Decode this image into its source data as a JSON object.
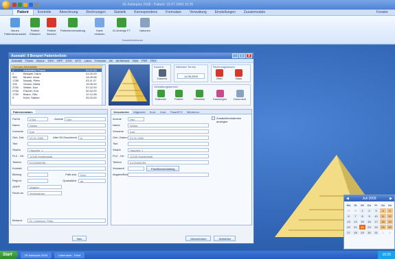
{
  "titlebar": {
    "title": "ZE Asklepios 2008 - Patient: 22.07.2009 10:25",
    "quick_access_colors": [
      "#d5372b",
      "#3d8f2e",
      "#e6b21c",
      "#2b6fd6",
      "#8a8a8a"
    ]
  },
  "menubar": {
    "tabs": [
      "Patient",
      "Kontrolle",
      "Abrechnung",
      "Rechnungen",
      "Statistik",
      "Korrespondenz",
      "Formulare",
      "Verwaltung",
      "Einstellungen",
      "Zusatzmodule"
    ],
    "active": 0,
    "right": "Fenster"
  },
  "ribbon": {
    "buttons": [
      {
        "label": "Neues Patientenauswahl",
        "color": "#5a9be0"
      },
      {
        "label": "Patient Erfassen",
        "color": "#3e9b3a"
      },
      {
        "label": "Patient löschen",
        "color": "#d5372b"
      },
      {
        "label": "Patientenverwaltung",
        "color": "#3e9b3a"
      },
      {
        "label": "Karte einlesen",
        "color": "#7aa6e6"
      },
      {
        "label": "ID-Anzeige F7",
        "color": "#3e9b3a"
      },
      {
        "label": "Optionen",
        "color": "#8aa2c2"
      }
    ],
    "group_label": "Zusatzfunktionen"
  },
  "window": {
    "title": "Auswahl: 0  Beispiel  Patientenliste",
    "controls": [
      "_",
      "□",
      "X"
    ],
    "alphabet": [
      "Auswahl",
      "Praxis",
      "Bonus",
      "GKV",
      "HPF",
      "KOS",
      "KFO",
      "Labor",
      "Formular",
      "Alt",
      "ab Behand",
      "Hkst",
      "PSR",
      "PKV"
    ],
    "list_header": "Chequer  Arbeitsliste",
    "list_rows": [
      {
        "id": "1",
        "name": "Arbeitsliste Praxis",
        "date": "22.07.09",
        "selected": true
      },
      {
        "id": "2",
        "name": "Beispiel, Hans",
        "date": "01.02.09",
        "selected": false
      },
      {
        "id": "986",
        "name": "Muster, Anna",
        "date": "14.05.08",
        "selected": false
      },
      {
        "id": "1785",
        "name": "Nowak, Peter",
        "date": "03.11.07",
        "selected": false
      },
      {
        "id": "126",
        "name": "Schulz, Maria",
        "date": "19.06.09",
        "selected": false
      },
      {
        "id": "2784",
        "name": "Weber, Karl",
        "date": "07.02.09",
        "selected": false
      },
      {
        "id": "2766",
        "name": "Fischer, Eva",
        "date": "30.04.09",
        "selected": false
      },
      {
        "id": "1790",
        "name": "Braun, Otto",
        "date": "12.12.08",
        "selected": false
      },
      {
        "id": "5",
        "name": "Klein, Sabine",
        "date": "25.03.09",
        "selected": false
      }
    ],
    "kamera": {
      "label": "Kamera",
      "button": "Kamera"
    },
    "next_appt": {
      "label": "Nächster Termin",
      "value": "11.08.2009"
    },
    "patient_group": {
      "label": "Rechnungswesen",
      "buttons": [
        "Rein",
        "Raus"
      ]
    },
    "verwaltung": {
      "label": "Verwaltungsbereich",
      "buttons": [
        "Kalender",
        "Patient",
        "Hinweise",
        "Kassengen",
        "Dokument"
      ]
    },
    "left_panel": {
      "tabs": [
        "Patientendaten"
      ],
      "fields": [
        {
          "label": "Pat.Nr",
          "value": "2784",
          "extra_label": "Anrede",
          "extra_value": "Herr"
        },
        {
          "label": "Name",
          "value": "Weber"
        },
        {
          "label": "Vorname",
          "value": "Karl"
        },
        {
          "label": "Geb. Dat.",
          "value": "01.01.1960",
          "extra_label": "Alter 55  Geschlecht",
          "extra_value": "m"
        },
        {
          "label": "Titel",
          "value": ""
        },
        {
          "label": "Straße",
          "value": "Hauptstr. 1"
        },
        {
          "label": "PLZ - Ort",
          "value": "12345 Musterstadt"
        },
        {
          "label": "Telefon",
          "value": "0123/456789"
        },
        {
          "label": "Kontakt",
          "value": ""
        },
        {
          "label": "Bildung",
          "value": "",
          "extra_label": "Patb.stat.",
          "extra_value": "Kein"
        },
        {
          "label": "Regt.bt.",
          "value": "",
          "extra_label": "Quartalsbtr.",
          "extra_value": "ab"
        },
        {
          "label": "GRPP",
          "value": "Abgabe"
        },
        {
          "label": "Recht an",
          "value": "Versicherten"
        }
      ],
      "footer_label": "Behand.",
      "footer_value": "Dr. Lehmann, Peter"
    },
    "right_panel": {
      "tabs": [
        "Versicherter",
        "Allgemein",
        "Kont.",
        "Zust.",
        "Para/KFO",
        "Wiedervor."
      ],
      "checkbox_label": "Zusatzinformationen anzeigen",
      "fields": [
        {
          "label": "Anrede",
          "value": "Herr"
        },
        {
          "label": "Name",
          "value": "Weber"
        },
        {
          "label": "Vorname",
          "value": "Karl"
        },
        {
          "label": "Geb. Datum",
          "value": "01.01.1960"
        },
        {
          "label": "Titel",
          "value": ""
        },
        {
          "label": "Straße",
          "value": "Hauptstr. 1"
        },
        {
          "label": "PLZ - Ort",
          "value": "12345 Musterstadt"
        },
        {
          "label": "Telefon",
          "value": "0123/456789"
        },
        {
          "label": "Verwandt",
          "value": "",
          "button": "Familienverwaltung"
        },
        {
          "label": "Abgabe/Bed.",
          "value": ""
        }
      ]
    },
    "footer_buttons": [
      "Neu",
      "Übernehmen",
      "Schließen"
    ]
  },
  "calendar": {
    "month": "Juli 2009",
    "days_of_week": [
      "Mo",
      "Di",
      "Mi",
      "Do",
      "Fr",
      "Sa",
      "So"
    ],
    "days": [
      "29",
      "30",
      "1",
      "2",
      "3",
      "4",
      "5",
      "6",
      "7",
      "8",
      "9",
      "10",
      "11",
      "12",
      "13",
      "14",
      "15",
      "16",
      "17",
      "18",
      "19",
      "20",
      "21",
      "22",
      "23",
      "24",
      "25",
      "26",
      "27",
      "28",
      "29",
      "30",
      "31",
      "1",
      "2"
    ],
    "today": "22"
  },
  "taskbar": {
    "start": "Start",
    "items": [
      "ZE Asklepios 2008",
      "Unbenannt - Paint"
    ],
    "clock": "10:25"
  }
}
